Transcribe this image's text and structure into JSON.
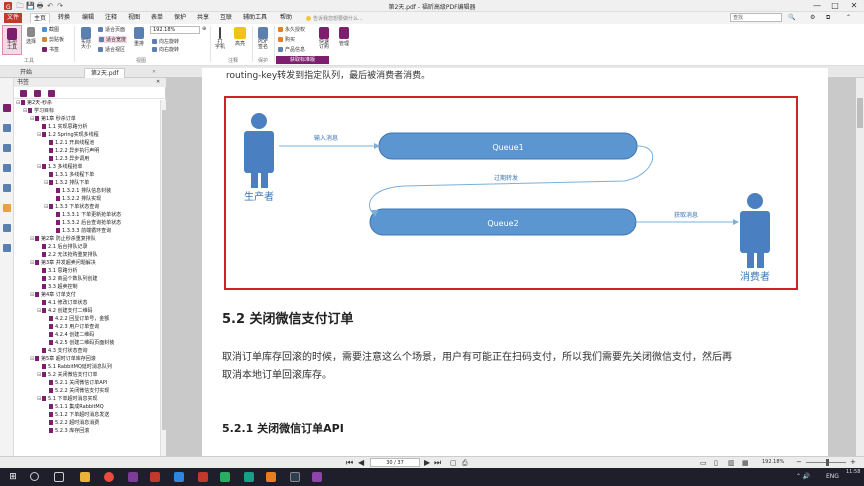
{
  "window": {
    "title": "第2天.pdf - 福昕高级PDF编辑器",
    "minimize": "—",
    "maximize": "□",
    "close": "✕"
  },
  "quickaccess": [
    "🗀",
    "💾",
    "🖶",
    "↶",
    "↷"
  ],
  "menu": [
    "文件",
    "主页",
    "转换",
    "编辑",
    "注释",
    "视图",
    "表单",
    "保护",
    "共享",
    "互联",
    "辅助工具",
    "帮助"
  ],
  "search": {
    "tell": "告诉我您想要做什么...",
    "placeholder": "查找"
  },
  "ribbon": {
    "hand": "手型\n工具",
    "select": "选择",
    "snapshot": "截图",
    "clipboard": "剪贴板",
    "bookmark": "书签",
    "actual": "实际\n大小",
    "fitpage": "适合页面",
    "fitwidth": "适合宽度",
    "fitvisible": "适合视区",
    "reflow": "重排",
    "zoom": "192.18%",
    "rotleft": "向左旋转",
    "rotright": "向右旋转",
    "typewriter": "打\n字机",
    "highlight": "高亮",
    "pdfsign": "PDF\n签名",
    "permanent": "永久授权",
    "subscribe": "购买",
    "product": "产品信息",
    "quickorder": "快速\n订购",
    "manage": "管理",
    "registered": "获取标准版",
    "groups": {
      "tools": "工具",
      "view": "视图",
      "comment": "注释",
      "protect": "保护"
    }
  },
  "tabs": [
    "开始",
    "第2天.pdf"
  ],
  "bookmarks": {
    "header": "书签",
    "items": [
      {
        "t": "第2天-秒杀",
        "lv": 0,
        "tg": "⊟"
      },
      {
        "t": "学习目标",
        "lv": 1,
        "tg": "⊟"
      },
      {
        "t": "第1章 秒杀订单",
        "lv": 2,
        "tg": "⊟"
      },
      {
        "t": "1.1 实现思路分析",
        "lv": 3,
        "tg": ""
      },
      {
        "t": "1.2 Spring实现多线程",
        "lv": 3,
        "tg": "⊟"
      },
      {
        "t": "1.2.1 开启线程池",
        "lv": 4,
        "tg": ""
      },
      {
        "t": "1.2.2 异步执行声明",
        "lv": 4,
        "tg": ""
      },
      {
        "t": "1.2.3 异步调用",
        "lv": 4,
        "tg": ""
      },
      {
        "t": "1.3 多线程抢单",
        "lv": 3,
        "tg": "⊟"
      },
      {
        "t": "1.3.1 多线程下单",
        "lv": 4,
        "tg": ""
      },
      {
        "t": "1.3.2 排队下单",
        "lv": 4,
        "tg": "⊟"
      },
      {
        "t": "1.3.2.1 排队信息封装",
        "lv": 5,
        "tg": ""
      },
      {
        "t": "1.3.2.2 排队实现",
        "lv": 5,
        "tg": ""
      },
      {
        "t": "1.3.3 下单状态查询",
        "lv": 4,
        "tg": "⊟"
      },
      {
        "t": "1.3.3.1 下单更新抢单状态",
        "lv": 5,
        "tg": ""
      },
      {
        "t": "1.3.3.2 后台查询抢单状态",
        "lv": 5,
        "tg": ""
      },
      {
        "t": "1.3.3.3 前端循环查询",
        "lv": 5,
        "tg": ""
      },
      {
        "t": "第2章 防止秒杀重复排队",
        "lv": 2,
        "tg": "⊟"
      },
      {
        "t": "2.1 后台排队记录",
        "lv": 3,
        "tg": ""
      },
      {
        "t": "2.2 无法抢购重复排队",
        "lv": 3,
        "tg": ""
      },
      {
        "t": "第3章 并发超卖问题解决",
        "lv": 2,
        "tg": "⊟"
      },
      {
        "t": "3.1 思路分析",
        "lv": 3,
        "tg": ""
      },
      {
        "t": "3.2 商品个数队列创建",
        "lv": 3,
        "tg": ""
      },
      {
        "t": "3.3 超卖控制",
        "lv": 3,
        "tg": ""
      },
      {
        "t": "第4章 订单支付",
        "lv": 2,
        "tg": "⊟"
      },
      {
        "t": "4.1 修改订单状态",
        "lv": 3,
        "tg": ""
      },
      {
        "t": "4.2 创建支付二维码",
        "lv": 3,
        "tg": "⊟"
      },
      {
        "t": "4.2.2 回显订单号，金额",
        "lv": 4,
        "tg": ""
      },
      {
        "t": "4.2.3 用户订单查询",
        "lv": 4,
        "tg": ""
      },
      {
        "t": "4.2.4 创建二维码",
        "lv": 4,
        "tg": ""
      },
      {
        "t": "4.2.5 创建二维码页面封装",
        "lv": 4,
        "tg": ""
      },
      {
        "t": "4.3 支付状态查询",
        "lv": 3,
        "tg": ""
      },
      {
        "t": "第5章 超时订单库存回滚",
        "lv": 2,
        "tg": "⊟"
      },
      {
        "t": "5.1 RabbitMQ延时消息队列",
        "lv": 3,
        "tg": ""
      },
      {
        "t": "5.2 关闭微信支付订单",
        "lv": 3,
        "tg": "⊟"
      },
      {
        "t": "5.2.1 关闭微信订单API",
        "lv": 4,
        "tg": ""
      },
      {
        "t": "5.2.2 关闭微信支付实现",
        "lv": 4,
        "tg": ""
      },
      {
        "t": "5.1 下单超时消息实现",
        "lv": 3,
        "tg": "⊟"
      },
      {
        "t": "5.1.1 集成RabbitMQ",
        "lv": 4,
        "tg": ""
      },
      {
        "t": "5.1.2 下单超时消息发送",
        "lv": 4,
        "tg": ""
      },
      {
        "t": "5.2.2 超时消息消费",
        "lv": 4,
        "tg": ""
      },
      {
        "t": "5.2.3 库存回滚",
        "lv": 4,
        "tg": ""
      }
    ]
  },
  "doc": {
    "topline": "routing-key转发到指定队列，最后被消费者消费。",
    "diagram": {
      "producer": "生产者",
      "consumer": "消费者",
      "queue1": "Queue1",
      "queue2": "Queue2",
      "deliver": "输入消息",
      "expire": "过期转发",
      "fetch": "获取消息"
    },
    "heading": "5.2 关闭微信支付订单",
    "para1": "取消订单库存回滚的时候，需要注意这么个场景，用户有可能正在扫码支付，所以我们需要先关闭微信支付，然后再",
    "para2": "取消本地订单回滚库存。",
    "subheading": "5.2.1 关闭微信订单API"
  },
  "status": {
    "page": "30 / 37",
    "zoom": "192.18%"
  },
  "taskbar": {
    "lang": "ENG",
    "time": "11:58",
    "date": "2020/3/17"
  }
}
